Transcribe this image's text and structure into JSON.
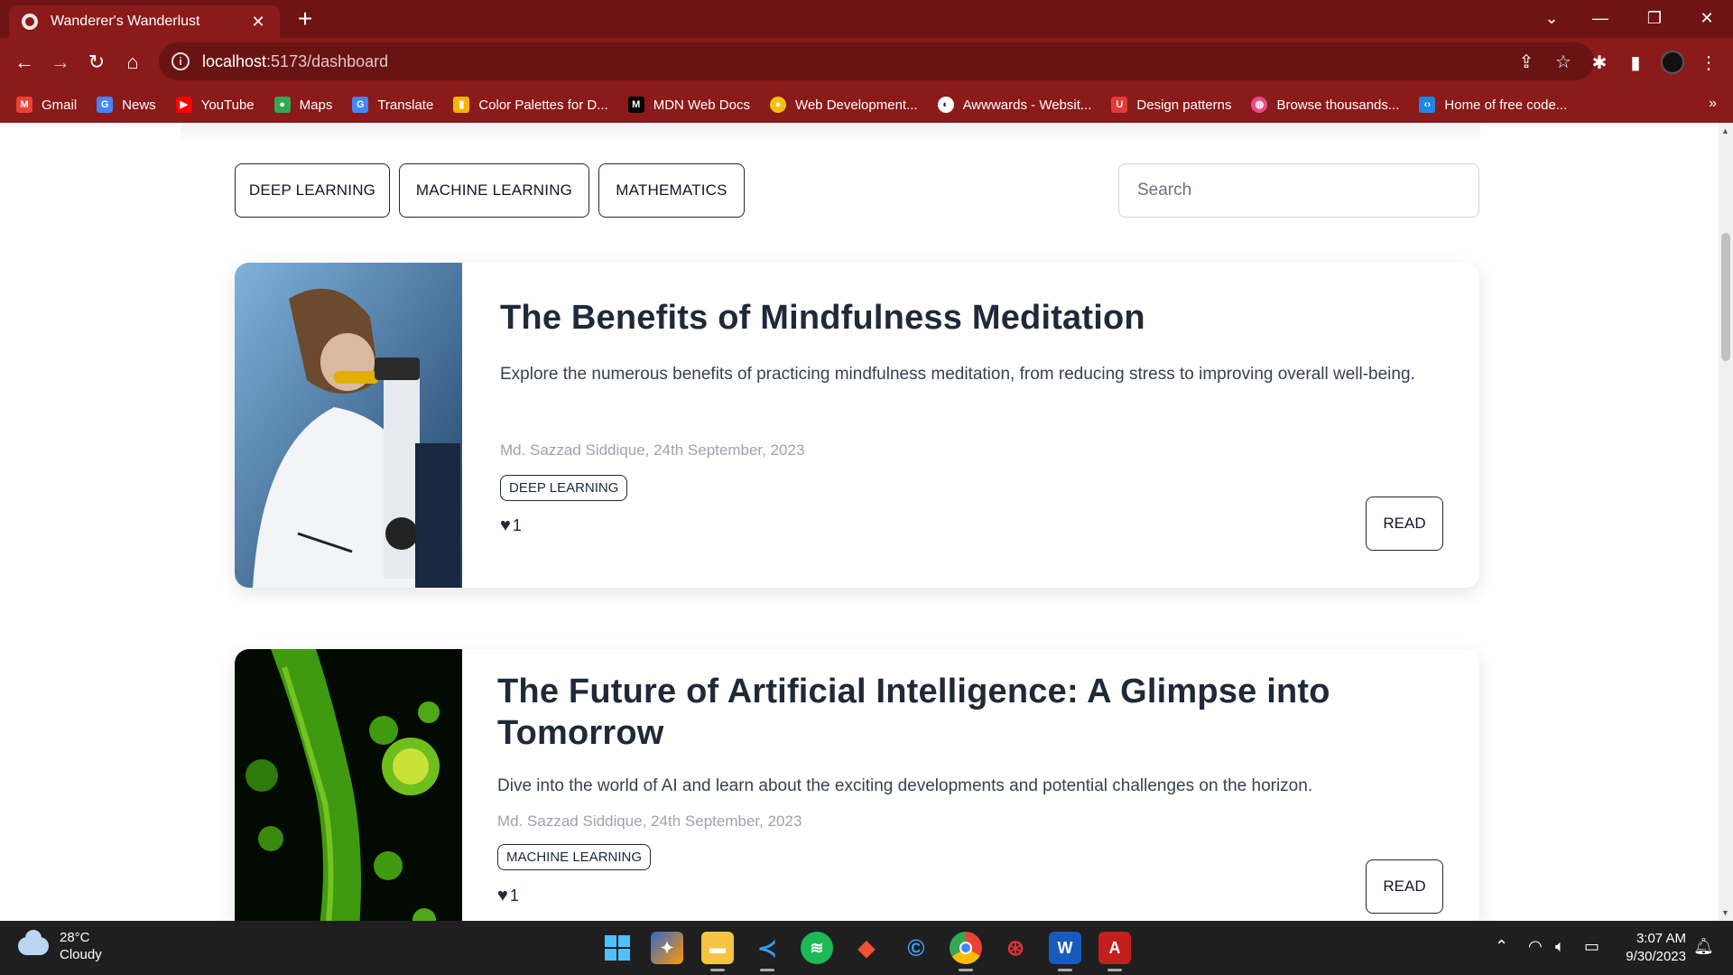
{
  "browser": {
    "tab_title": "Wanderer's Wanderlust",
    "url_host": "localhost",
    "url_path": ":5173/dashboard",
    "bookmarks": [
      {
        "label": "Gmail",
        "icon": "gmail-icon",
        "color": "#ea4335"
      },
      {
        "label": "News",
        "icon": "google-news-icon",
        "color": "#4285f4"
      },
      {
        "label": "YouTube",
        "icon": "youtube-icon",
        "color": "#ff0000"
      },
      {
        "label": "Maps",
        "icon": "maps-icon",
        "color": "#34a853"
      },
      {
        "label": "Translate",
        "icon": "translate-icon",
        "color": "#4285f4"
      },
      {
        "label": "Color Palettes for D...",
        "icon": "color-palettes-icon",
        "color": "#f4b400"
      },
      {
        "label": "MDN Web Docs",
        "icon": "mdn-icon",
        "color": "#000000"
      },
      {
        "label": "Web Development...",
        "icon": "webdev-icon",
        "color": "#f4c20d"
      },
      {
        "label": "Awwwards - Websit...",
        "icon": "awwwards-icon",
        "color": "#222222"
      },
      {
        "label": "Design patterns",
        "icon": "ui-patterns-icon",
        "color": "#e53935"
      },
      {
        "label": "Browse thousands...",
        "icon": "dribbble-icon",
        "color": "#ea4c89"
      },
      {
        "label": "Home of free code...",
        "icon": "codepen-icon",
        "color": "#1e88e5"
      }
    ]
  },
  "filters": {
    "categories": [
      "DEEP LEARNING",
      "MACHINE LEARNING",
      "MATHEMATICS"
    ],
    "search_placeholder": "Search"
  },
  "posts": [
    {
      "title": "The Benefits of Mindfulness Meditation",
      "description": "Explore the numerous benefits of practicing mindfulness meditation, from reducing stress to improving overall well-being.",
      "author_date": "Md. Sazzad Siddique, 24th September, 2023",
      "tag": "DEEP LEARNING",
      "likes": "1",
      "read_label": "READ",
      "image": "scientist-microscope-photo"
    },
    {
      "title": "The Future of Artificial Intelligence: A Glimpse into Tomorrow",
      "description": "Dive into the world of AI and learn about the exciting developments and potential challenges on the horizon.",
      "author_date": "Md. Sazzad Siddique, 24th September, 2023",
      "tag": "MACHINE LEARNING",
      "likes": "1",
      "read_label": "READ",
      "image": "green-virus-micrograph"
    }
  ],
  "taskbar": {
    "weather_temp": "28°C",
    "weather_desc": "Cloudy",
    "time": "3:07 AM",
    "date": "9/30/2023"
  }
}
